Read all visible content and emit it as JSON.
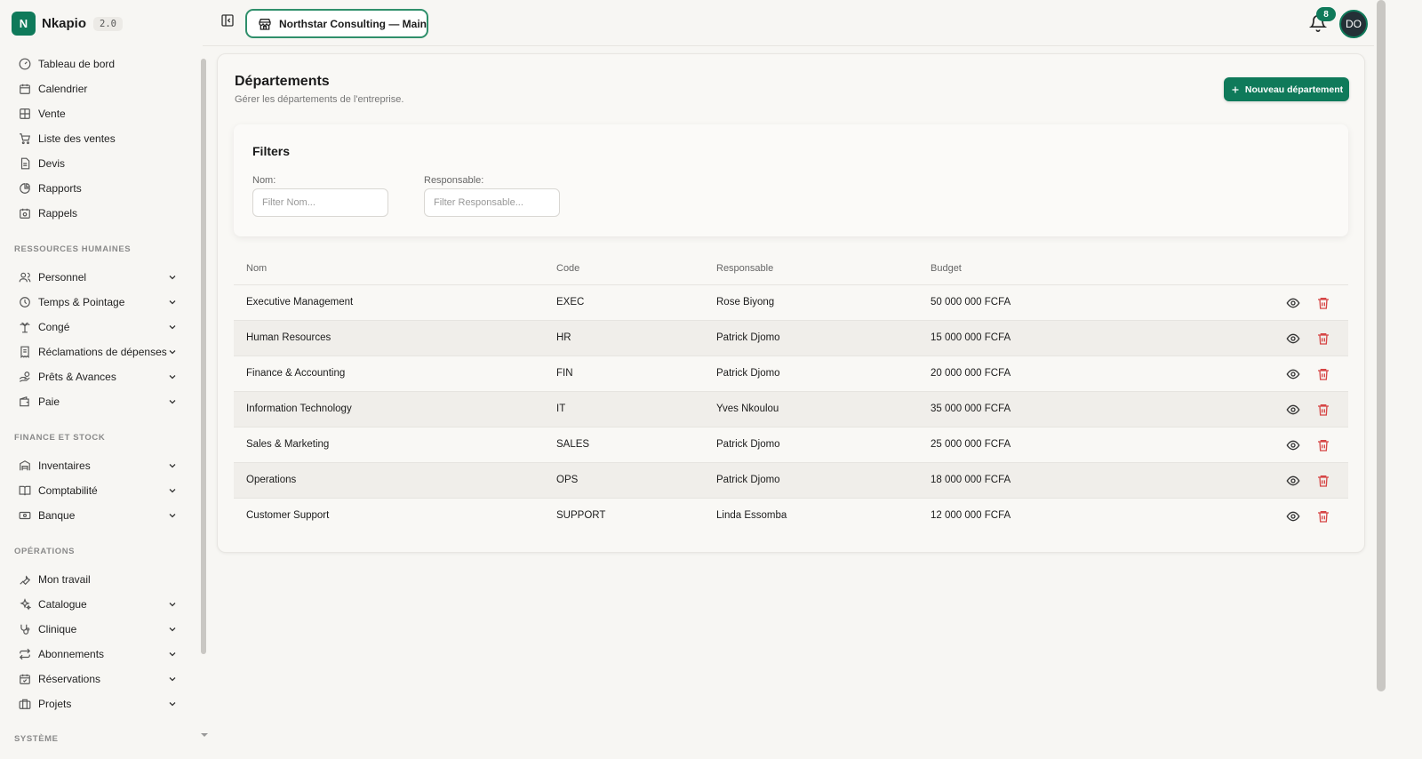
{
  "app": {
    "name": "Nkapio",
    "version": "2.0",
    "logo_letter": "N"
  },
  "sidebar": {
    "main_items": [
      {
        "label": "Tableau de bord",
        "icon": "gauge-icon"
      },
      {
        "label": "Calendrier",
        "icon": "calendar-icon"
      },
      {
        "label": "Vente",
        "icon": "grid-icon"
      },
      {
        "label": "Liste des ventes",
        "icon": "cart-icon"
      },
      {
        "label": "Devis",
        "icon": "document-icon"
      },
      {
        "label": "Rapports",
        "icon": "pie-chart-icon"
      },
      {
        "label": "Rappels",
        "icon": "calendar-clock-icon"
      }
    ],
    "hr_section": "RESSOURCES HUMAINES",
    "hr_items": [
      {
        "label": "Personnel",
        "icon": "users-icon"
      },
      {
        "label": "Temps & Pointage",
        "icon": "clock-icon"
      },
      {
        "label": "Congé",
        "icon": "palm-icon"
      },
      {
        "label": "Réclamations de dépenses",
        "icon": "receipt-icon"
      },
      {
        "label": "Prêts & Avances",
        "icon": "hand-coins-icon"
      },
      {
        "label": "Paie",
        "icon": "wallet-icon"
      }
    ],
    "finance_section": "FINANCE ET STOCK",
    "finance_items": [
      {
        "label": "Inventaires",
        "icon": "warehouse-icon"
      },
      {
        "label": "Comptabilité",
        "icon": "book-icon"
      },
      {
        "label": "Banque",
        "icon": "banknote-icon"
      }
    ],
    "ops_section": "OPÉRATIONS",
    "ops_items": [
      {
        "label": "Mon travail",
        "icon": "wrench-icon"
      },
      {
        "label": "Catalogue",
        "icon": "sparkles-icon"
      },
      {
        "label": "Clinique",
        "icon": "stethoscope-icon"
      },
      {
        "label": "Abonnements",
        "icon": "repeat-icon"
      },
      {
        "label": "Réservations",
        "icon": "calendar-check-icon"
      },
      {
        "label": "Projets",
        "icon": "briefcase-icon"
      }
    ],
    "system_section": "SYSTÈME"
  },
  "header": {
    "organization": "Northstar Consulting — Main",
    "notifications_count": "8",
    "avatar_initials": "DO"
  },
  "page": {
    "title": "Départements",
    "subtitle": "Gérer les départements de l'entreprise.",
    "new_button": "Nouveau département"
  },
  "filters": {
    "title": "Filters",
    "name_label": "Nom:",
    "name_placeholder": "Filter Nom...",
    "manager_label": "Responsable:",
    "manager_placeholder": "Filter Responsable..."
  },
  "table": {
    "columns": [
      "Nom",
      "Code",
      "Responsable",
      "Budget"
    ],
    "rows": [
      {
        "name": "Executive Management",
        "code": "EXEC",
        "manager": "Rose Biyong",
        "budget": "50 000 000 FCFA"
      },
      {
        "name": "Human Resources",
        "code": "HR",
        "manager": "Patrick Djomo",
        "budget": "15 000 000 FCFA"
      },
      {
        "name": "Finance & Accounting",
        "code": "FIN",
        "manager": "Patrick Djomo",
        "budget": "20 000 000 FCFA"
      },
      {
        "name": "Information Technology",
        "code": "IT",
        "manager": "Yves Nkoulou",
        "budget": "35 000 000 FCFA"
      },
      {
        "name": "Sales & Marketing",
        "code": "SALES",
        "manager": "Patrick Djomo",
        "budget": "25 000 000 FCFA"
      },
      {
        "name": "Operations",
        "code": "OPS",
        "manager": "Patrick Djomo",
        "budget": "18 000 000 FCFA"
      },
      {
        "name": "Customer Support",
        "code": "SUPPORT",
        "manager": "Linda Essomba",
        "budget": "12 000 000 FCFA"
      }
    ]
  },
  "colors": {
    "accent": "#0f7a5a",
    "danger": "#d64545",
    "background": "#f7f6f3"
  }
}
